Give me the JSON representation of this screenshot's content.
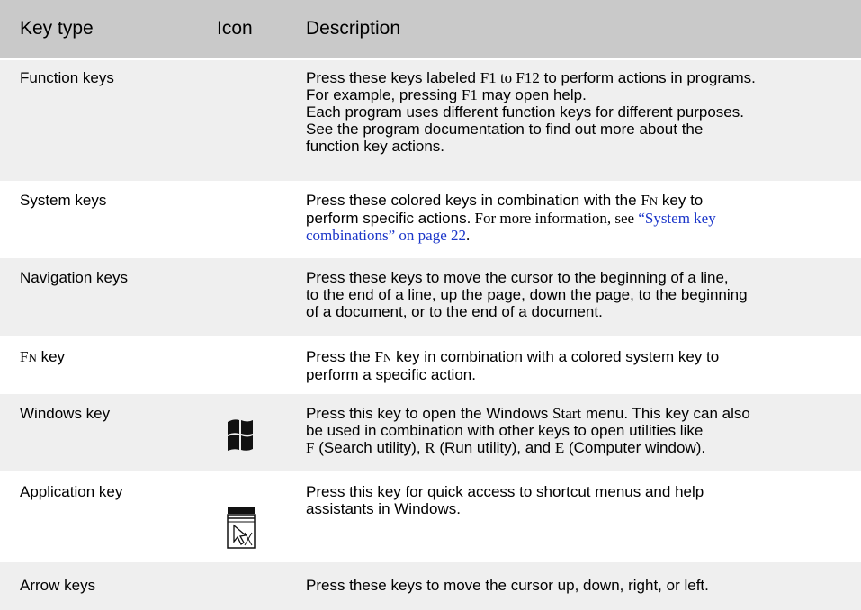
{
  "header": {
    "key_type": "Key type",
    "icon": "Icon",
    "description": "Description"
  },
  "rows": [
    {
      "key_type": "Function keys",
      "desc": {
        "l1a": "Press these keys labeled ",
        "f1": "F1",
        "l1b": " to ",
        "f12": "F12",
        "l1c": " to perform actions in programs.",
        "l2a": "For example, pressing ",
        "f1b": "F1",
        "l2b": " may open help.",
        "l3": "Each program uses different function keys for different purposes.",
        "l4": "See the program documentation to find out more about the",
        "l5": "function key actions."
      }
    },
    {
      "key_type": "System keys",
      "desc": {
        "l1a": "Press these colored keys in combination with the ",
        "fn_f": "F",
        "fn_n": "N",
        "l1b": " key to",
        "l2a": "perform specific actions.",
        "l2b": " For more information, see ",
        "link1": "“System key",
        "link2": "combinations” on page 22",
        "l3end": "."
      }
    },
    {
      "key_type": "Navigation keys",
      "desc": {
        "l1": "Press these keys to move the cursor to the beginning of a line,",
        "l2": "to the end of a line, up the page, down the page, to the beginning",
        "l3": "of a document, or to the end of a document."
      }
    },
    {
      "key_type_f": "F",
      "key_type_n": "N",
      "key_type_rest": " key",
      "desc": {
        "l1a": "Press the ",
        "fn_f": "F",
        "fn_n": "N",
        "l1b": " key in combination with a colored system key to",
        "l2": "perform a specific action."
      }
    },
    {
      "key_type": "Windows key",
      "icon": "windows-logo-icon",
      "desc": {
        "l1a": "Press this key to open the Windows ",
        "start": "Start",
        "l1b": " menu. This key can also",
        "l2": "be used in combination with other keys to open utilities like",
        "k_f": "F",
        "l3a": " (Search utility), ",
        "k_r": "R",
        "l3b": " (Run utility), and ",
        "k_e": "E",
        "l3c": " (Computer window)."
      }
    },
    {
      "key_type": "Application key",
      "icon": "application-menu-icon",
      "desc": {
        "l1": "Press this key for quick access to shortcut menus and help",
        "l2": "assistants in Windows."
      }
    },
    {
      "key_type": "Arrow keys",
      "desc": {
        "l1": "Press these keys to move the cursor up, down, right, or left."
      }
    }
  ],
  "colors": {
    "header_bg": "#c9c9c9",
    "shade_bg": "#efefef",
    "link": "#1a35c9"
  }
}
